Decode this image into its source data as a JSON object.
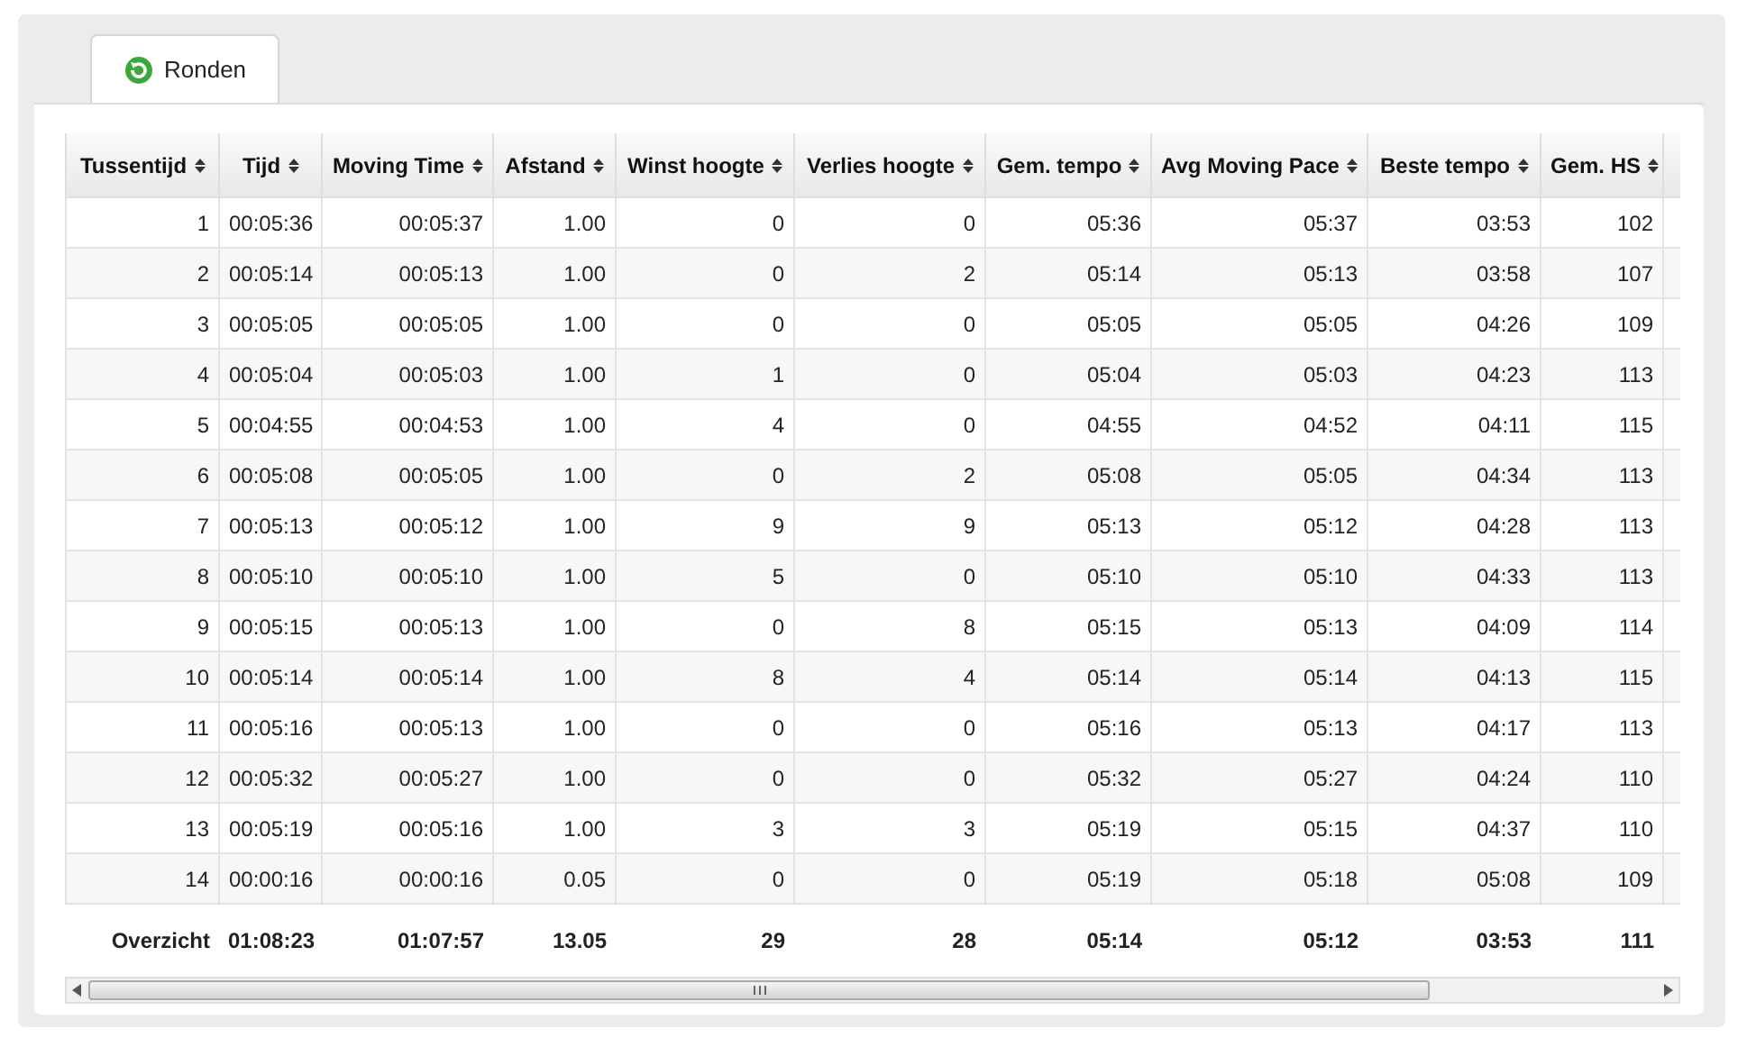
{
  "tabs": [
    {
      "label": "Ronden",
      "selected": true
    }
  ],
  "table": {
    "columns": [
      "Tussentijd",
      "Tijd",
      "Moving Time",
      "Afstand",
      "Winst hoogte",
      "Verlies hoogte",
      "Gem. tempo",
      "Avg Moving Pace",
      "Beste tempo",
      "Gem. HS"
    ],
    "rows": [
      [
        "1",
        "00:05:36",
        "00:05:37",
        "1.00",
        "0",
        "0",
        "05:36",
        "05:37",
        "03:53",
        "102"
      ],
      [
        "2",
        "00:05:14",
        "00:05:13",
        "1.00",
        "0",
        "2",
        "05:14",
        "05:13",
        "03:58",
        "107"
      ],
      [
        "3",
        "00:05:05",
        "00:05:05",
        "1.00",
        "0",
        "0",
        "05:05",
        "05:05",
        "04:26",
        "109"
      ],
      [
        "4",
        "00:05:04",
        "00:05:03",
        "1.00",
        "1",
        "0",
        "05:04",
        "05:03",
        "04:23",
        "113"
      ],
      [
        "5",
        "00:04:55",
        "00:04:53",
        "1.00",
        "4",
        "0",
        "04:55",
        "04:52",
        "04:11",
        "115"
      ],
      [
        "6",
        "00:05:08",
        "00:05:05",
        "1.00",
        "0",
        "2",
        "05:08",
        "05:05",
        "04:34",
        "113"
      ],
      [
        "7",
        "00:05:13",
        "00:05:12",
        "1.00",
        "9",
        "9",
        "05:13",
        "05:12",
        "04:28",
        "113"
      ],
      [
        "8",
        "00:05:10",
        "00:05:10",
        "1.00",
        "5",
        "0",
        "05:10",
        "05:10",
        "04:33",
        "113"
      ],
      [
        "9",
        "00:05:15",
        "00:05:13",
        "1.00",
        "0",
        "8",
        "05:15",
        "05:13",
        "04:09",
        "114"
      ],
      [
        "10",
        "00:05:14",
        "00:05:14",
        "1.00",
        "8",
        "4",
        "05:14",
        "05:14",
        "04:13",
        "115"
      ],
      [
        "11",
        "00:05:16",
        "00:05:13",
        "1.00",
        "0",
        "0",
        "05:16",
        "05:13",
        "04:17",
        "113"
      ],
      [
        "12",
        "00:05:32",
        "00:05:27",
        "1.00",
        "0",
        "0",
        "05:32",
        "05:27",
        "04:24",
        "110"
      ],
      [
        "13",
        "00:05:19",
        "00:05:16",
        "1.00",
        "3",
        "3",
        "05:19",
        "05:15",
        "04:37",
        "110"
      ],
      [
        "14",
        "00:00:16",
        "00:00:16",
        "0.05",
        "0",
        "0",
        "05:19",
        "05:18",
        "05:08",
        "109"
      ]
    ],
    "summary": [
      "Overzicht",
      "01:08:23",
      "01:07:57",
      "13.05",
      "29",
      "28",
      "05:14",
      "05:12",
      "03:53",
      "111"
    ]
  }
}
